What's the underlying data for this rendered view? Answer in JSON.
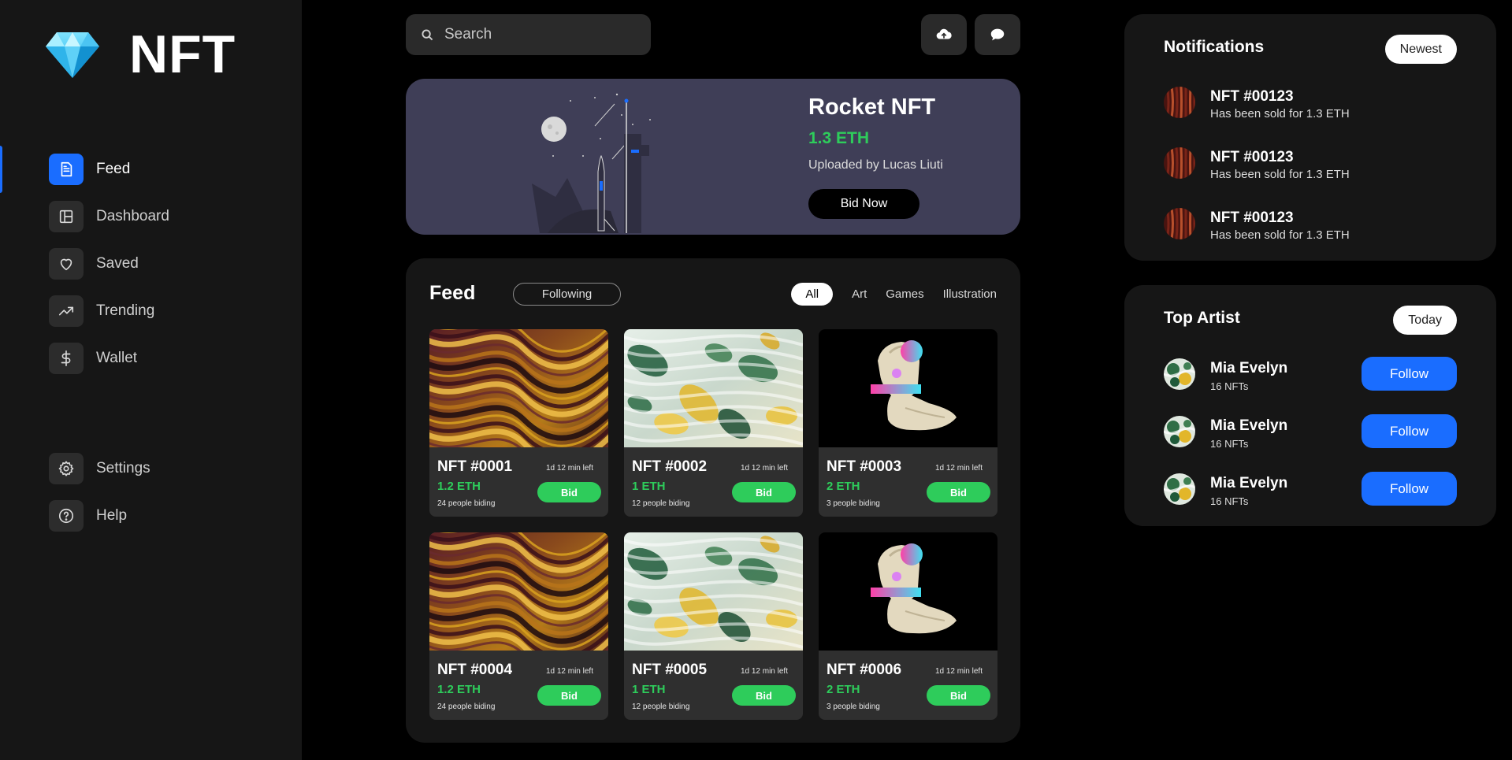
{
  "brand": {
    "name": "NFT",
    "logo_icon": "diamond-icon"
  },
  "nav": {
    "items": [
      {
        "label": "Feed",
        "icon": "document-icon",
        "active": true
      },
      {
        "label": "Dashboard",
        "icon": "layout-icon"
      },
      {
        "label": "Saved",
        "icon": "heart-icon"
      },
      {
        "label": "Trending",
        "icon": "trending-icon"
      },
      {
        "label": "Wallet",
        "icon": "dollar-icon"
      }
    ],
    "bottom": [
      {
        "label": "Settings",
        "icon": "gear-icon"
      },
      {
        "label": "Help",
        "icon": "help-icon"
      }
    ]
  },
  "search": {
    "placeholder": "Search",
    "icon": "search-icon"
  },
  "toolbar": {
    "upload_icon": "cloud-upload-icon",
    "chat_icon": "chat-icon"
  },
  "hero": {
    "title": "Rocket NFT",
    "price": "1.3 ETH",
    "uploader": "Uploaded by Lucas Liuti",
    "button": "Bid Now"
  },
  "feed": {
    "title": "Feed",
    "following": "Following",
    "filters": [
      "All",
      "Art",
      "Games",
      "Illustration"
    ],
    "active_filter": "All",
    "cards": [
      {
        "name": "NFT #0001",
        "time": "1d 12 min left",
        "price": "1.2 ETH",
        "people": "24 people biding",
        "bid": "Bid",
        "art": "marble-gold"
      },
      {
        "name": "NFT #0002",
        "time": "1d 12 min left",
        "price": "1 ETH",
        "people": "12 people biding",
        "bid": "Bid",
        "art": "marble-green"
      },
      {
        "name": "NFT #0003",
        "time": "1d 12 min left",
        "price": "2 ETH",
        "people": "3 people biding",
        "bid": "Bid",
        "art": "statue"
      },
      {
        "name": "NFT #0004",
        "time": "1d 12 min left",
        "price": "1.2 ETH",
        "people": "24 people biding",
        "bid": "Bid",
        "art": "marble-gold"
      },
      {
        "name": "NFT #0005",
        "time": "1d 12 min left",
        "price": "1 ETH",
        "people": "12 people biding",
        "bid": "Bid",
        "art": "marble-green"
      },
      {
        "name": "NFT #0006",
        "time": "1d 12 min left",
        "price": "2 ETH",
        "people": "3 people biding",
        "bid": "Bid",
        "art": "statue"
      }
    ]
  },
  "notifications": {
    "title": "Notifications",
    "sort": "Newest",
    "items": [
      {
        "title": "NFT #00123",
        "text": "Has been sold for 1.3 ETH"
      },
      {
        "title": "NFT #00123",
        "text": "Has been sold for 1.3 ETH"
      },
      {
        "title": "NFT #00123",
        "text": "Has been sold for 1.3 ETH"
      }
    ]
  },
  "top_artist": {
    "title": "Top Artist",
    "period": "Today",
    "items": [
      {
        "name": "Mia Evelyn",
        "count": "16 NFTs",
        "button": "Follow"
      },
      {
        "name": "Mia Evelyn",
        "count": "16 NFTs",
        "button": "Follow"
      },
      {
        "name": "Mia Evelyn",
        "count": "16 NFTs",
        "button": "Follow"
      }
    ]
  },
  "colors": {
    "accent": "#1a6dff",
    "price_green": "#2ecc5b",
    "hero_bg": "#3f3e57",
    "panel_bg": "#161616"
  }
}
